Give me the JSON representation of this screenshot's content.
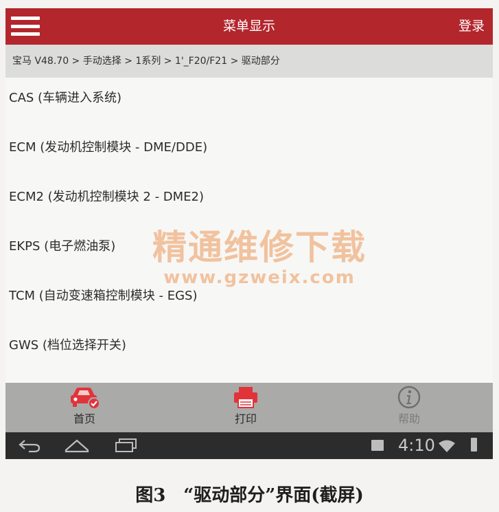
{
  "header": {
    "title": "菜单显示",
    "login_label": "登录",
    "menu_icon": "hamburger-menu-icon"
  },
  "breadcrumb": "宝马 V48.70 > 手动选择 > 1系列 > 1'_F20/F21 > 驱动部分",
  "list": {
    "items": [
      "CAS (车辆进入系统)",
      "ECM (发动机控制模块 - DME/DDE)",
      "ECM2 (发动机控制模块 2 - DME2)",
      "EKPS (电子燃油泵)",
      "TCM (自动变速箱控制模块 - EGS)",
      "GWS (档位选择开关)"
    ]
  },
  "watermark": {
    "text": "精通维修下载",
    "url": "www.gzweix.com"
  },
  "bottom_nav": {
    "home": {
      "label": "首页",
      "icon": "car-check-icon"
    },
    "print": {
      "label": "打印",
      "icon": "printer-icon"
    },
    "help": {
      "label": "帮助",
      "icon": "info-icon"
    }
  },
  "status_bar": {
    "time": "4:10"
  },
  "caption": "图3　“驱动部分”界面(截屏)",
  "colors": {
    "header": "#b3262c",
    "accent": "#e0343a",
    "breadcrumb_bg": "#dcdcdb",
    "bottom_bar": "#aaaaa8",
    "system_bar": "#2c2c2c",
    "watermark": "#f1c29e"
  }
}
